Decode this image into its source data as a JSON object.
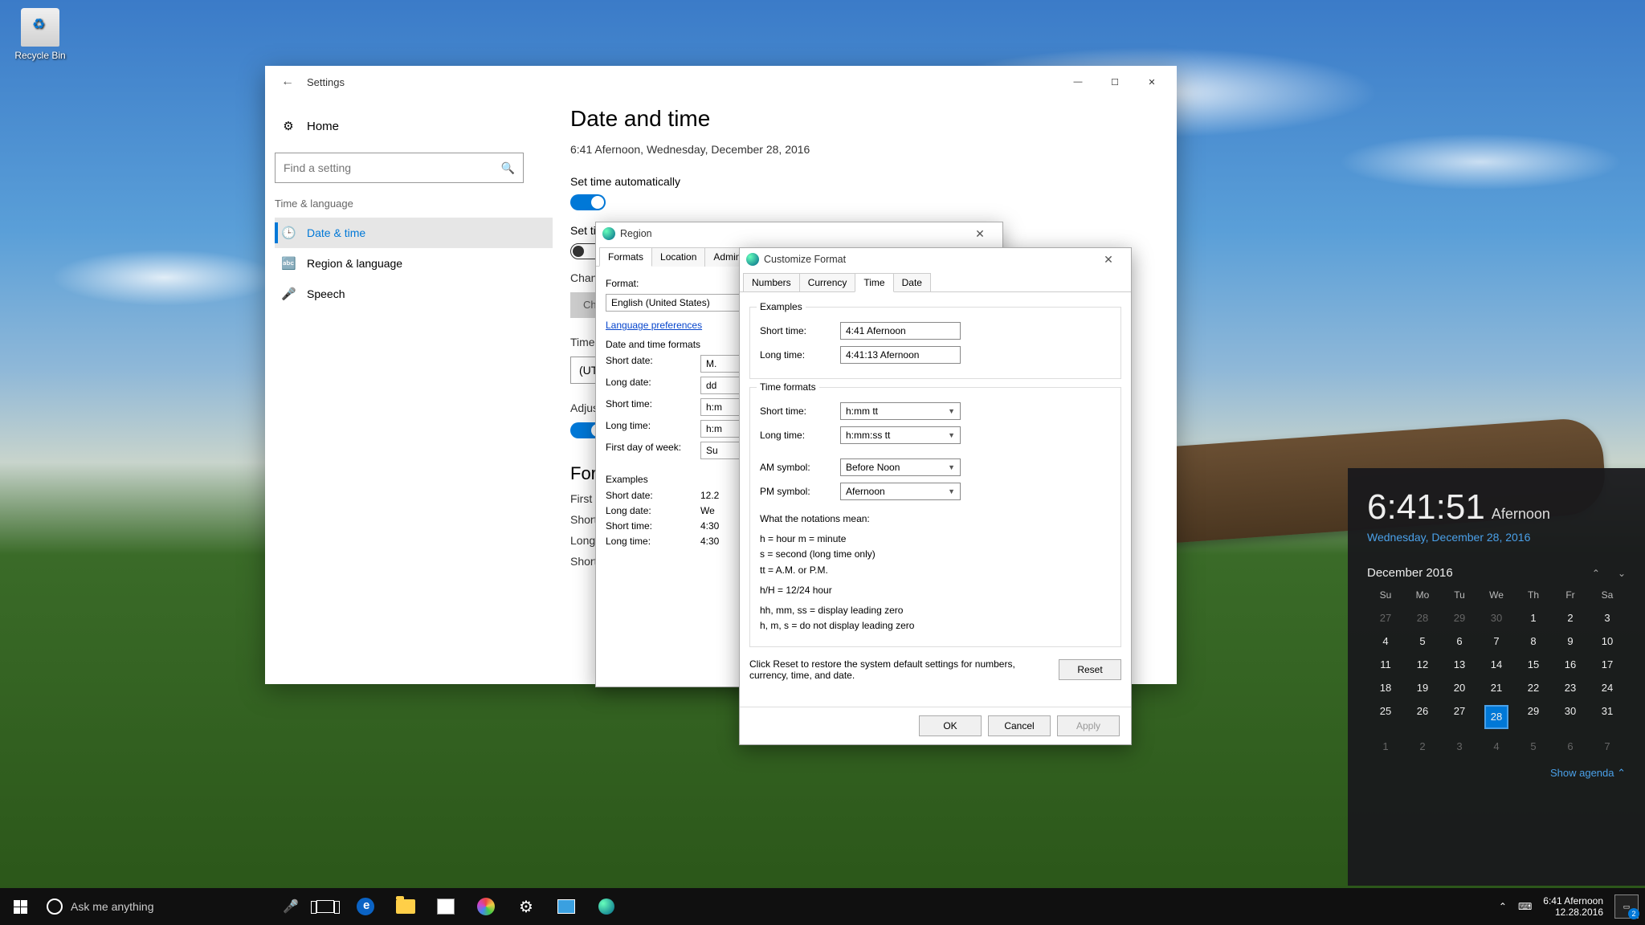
{
  "desktop": {
    "recycle_bin": "Recycle Bin"
  },
  "settings": {
    "title": "Settings",
    "home": "Home",
    "search_placeholder": "Find a setting",
    "category": "Time & language",
    "items": {
      "date_time": "Date & time",
      "region_language": "Region & language",
      "speech": "Speech"
    },
    "page": {
      "heading": "Date and time",
      "now": "6:41 Afernoon, Wednesday, December 28, 2016",
      "set_time_auto": "Set time automatically",
      "set_tz_auto_clipped": "Set tim",
      "change_clipped": "Chang",
      "change_btn": "Ch",
      "time_zone_clipped": "Time z",
      "tz_value_clipped": "(UTC",
      "adjust_dst_clipped": "Adjus",
      "formats_heading_clipped": "For",
      "first_clipped": "First d",
      "short_clipped2": "Short",
      "long_clipped": "Long t",
      "short_clipped3": "Short"
    }
  },
  "region": {
    "title": "Region",
    "tabs": {
      "formats": "Formats",
      "location": "Location",
      "administrative": "Administrati"
    },
    "format_label": "Format:",
    "format_value": "English (United States)",
    "lang_prefs": "Language preferences",
    "dt_formats": "Date and time formats",
    "rows": {
      "short_date": "Short date:",
      "short_date_v": "M.",
      "long_date": "Long date:",
      "long_date_v": "dd",
      "short_time": "Short time:",
      "short_time_v": "h:m",
      "long_time": "Long time:",
      "long_time_v": "h:m",
      "first_dow": "First day of week:",
      "first_dow_v": "Su"
    },
    "examples": "Examples",
    "ex": {
      "short_date": "Short date:",
      "short_date_v": "12.2",
      "long_date": "Long date:",
      "long_date_v": "We",
      "short_time": "Short time:",
      "short_time_v": "4:30",
      "long_time": "Long time:",
      "long_time_v": "4:30"
    }
  },
  "custom": {
    "title": "Customize Format",
    "tabs": {
      "numbers": "Numbers",
      "currency": "Currency",
      "time": "Time",
      "date": "Date"
    },
    "examples": "Examples",
    "ex_short_time_l": "Short time:",
    "ex_short_time_v": "4:41 Afernoon",
    "ex_long_time_l": "Long time:",
    "ex_long_time_v": "4:41:13 Afernoon",
    "time_formats": "Time formats",
    "tf_short_l": "Short time:",
    "tf_short_v": "h:mm tt",
    "tf_long_l": "Long time:",
    "tf_long_v": "h:mm:ss tt",
    "am_l": "AM symbol:",
    "am_v": "Before Noon",
    "pm_l": "PM symbol:",
    "pm_v": "Afernoon",
    "notations_h": "What the notations mean:",
    "notations_1": "h = hour   m = minute",
    "notations_2": "s = second (long time only)",
    "notations_3": "tt = A.M. or P.M.",
    "notations_4": "h/H = 12/24 hour",
    "notations_5": "hh, mm, ss = display leading zero",
    "notations_6": "h, m, s = do not display leading zero",
    "reset_text": "Click Reset to restore the system default settings for numbers, currency, time, and date.",
    "reset_btn": "Reset",
    "ok": "OK",
    "cancel": "Cancel",
    "apply": "Apply"
  },
  "clock": {
    "time": "6:41:51",
    "ampm": "Afernoon",
    "date": "Wednesday, December 28, 2016",
    "month": "December 2016",
    "dow": [
      "Su",
      "Mo",
      "Tu",
      "We",
      "Th",
      "Fr",
      "Sa"
    ],
    "weeks": [
      [
        {
          "n": "27",
          "dim": true
        },
        {
          "n": "28",
          "dim": true
        },
        {
          "n": "29",
          "dim": true
        },
        {
          "n": "30",
          "dim": true
        },
        {
          "n": "1"
        },
        {
          "n": "2"
        },
        {
          "n": "3"
        }
      ],
      [
        {
          "n": "4"
        },
        {
          "n": "5"
        },
        {
          "n": "6"
        },
        {
          "n": "7"
        },
        {
          "n": "8"
        },
        {
          "n": "9"
        },
        {
          "n": "10"
        }
      ],
      [
        {
          "n": "11"
        },
        {
          "n": "12"
        },
        {
          "n": "13"
        },
        {
          "n": "14"
        },
        {
          "n": "15"
        },
        {
          "n": "16"
        },
        {
          "n": "17"
        }
      ],
      [
        {
          "n": "18"
        },
        {
          "n": "19"
        },
        {
          "n": "20"
        },
        {
          "n": "21"
        },
        {
          "n": "22"
        },
        {
          "n": "23"
        },
        {
          "n": "24"
        }
      ],
      [
        {
          "n": "25"
        },
        {
          "n": "26"
        },
        {
          "n": "27"
        },
        {
          "n": "28",
          "today": true
        },
        {
          "n": "29"
        },
        {
          "n": "30"
        },
        {
          "n": "31"
        }
      ],
      [
        {
          "n": "1",
          "dim": true
        },
        {
          "n": "2",
          "dim": true
        },
        {
          "n": "3",
          "dim": true
        },
        {
          "n": "4",
          "dim": true
        },
        {
          "n": "5",
          "dim": true
        },
        {
          "n": "6",
          "dim": true
        },
        {
          "n": "7",
          "dim": true
        }
      ]
    ],
    "show_agenda": "Show agenda  ⌃"
  },
  "taskbar": {
    "search_placeholder": "Ask me anything",
    "tray_time": "6:41 Afernoon",
    "tray_date": "12.28.2016",
    "action_badge": "2"
  }
}
